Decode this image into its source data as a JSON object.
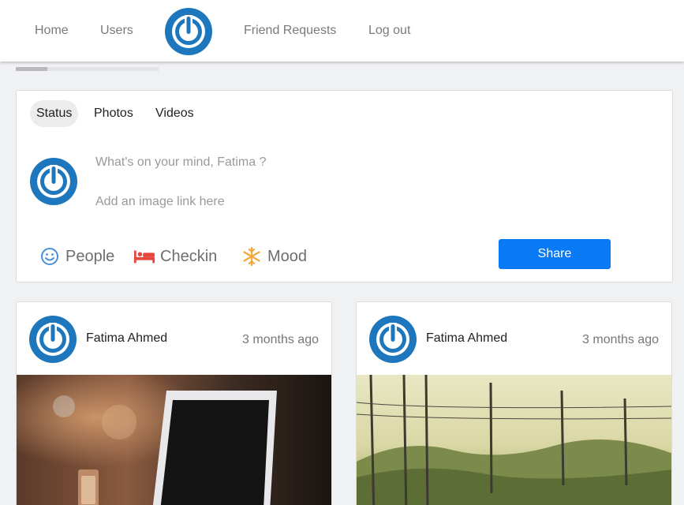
{
  "nav": {
    "home": "Home",
    "users": "Users",
    "friend_requests": "Friend Requests",
    "logout": "Log out"
  },
  "composer": {
    "tabs": [
      "Status",
      "Photos",
      "Videos"
    ],
    "active_tab": "Status",
    "status_placeholder": "What's on your mind,  Fatima ?",
    "image_link_placeholder": "Add an image link here",
    "actions": {
      "people": "People",
      "checkin": "Checkin",
      "mood": "Mood"
    },
    "share_label": "Share"
  },
  "posts": [
    {
      "author": "Fatima Ahmed",
      "time": "3 months ago",
      "image": "laptop-photo"
    },
    {
      "author": "Fatima Ahmed",
      "time": "3 months ago",
      "image": "railway-photo"
    }
  ],
  "icons": {
    "logo": "power-logo-icon",
    "people": "smiley-icon",
    "checkin": "bed-icon",
    "mood": "snowflake-icon"
  },
  "colors": {
    "brand_blue": "#1e77bd",
    "share_button": "#0a79f5",
    "checkin_icon": "#e8453c",
    "mood_icon": "#f3a93c",
    "people_icon": "#4a90d9"
  },
  "loading_progress": 0.22
}
